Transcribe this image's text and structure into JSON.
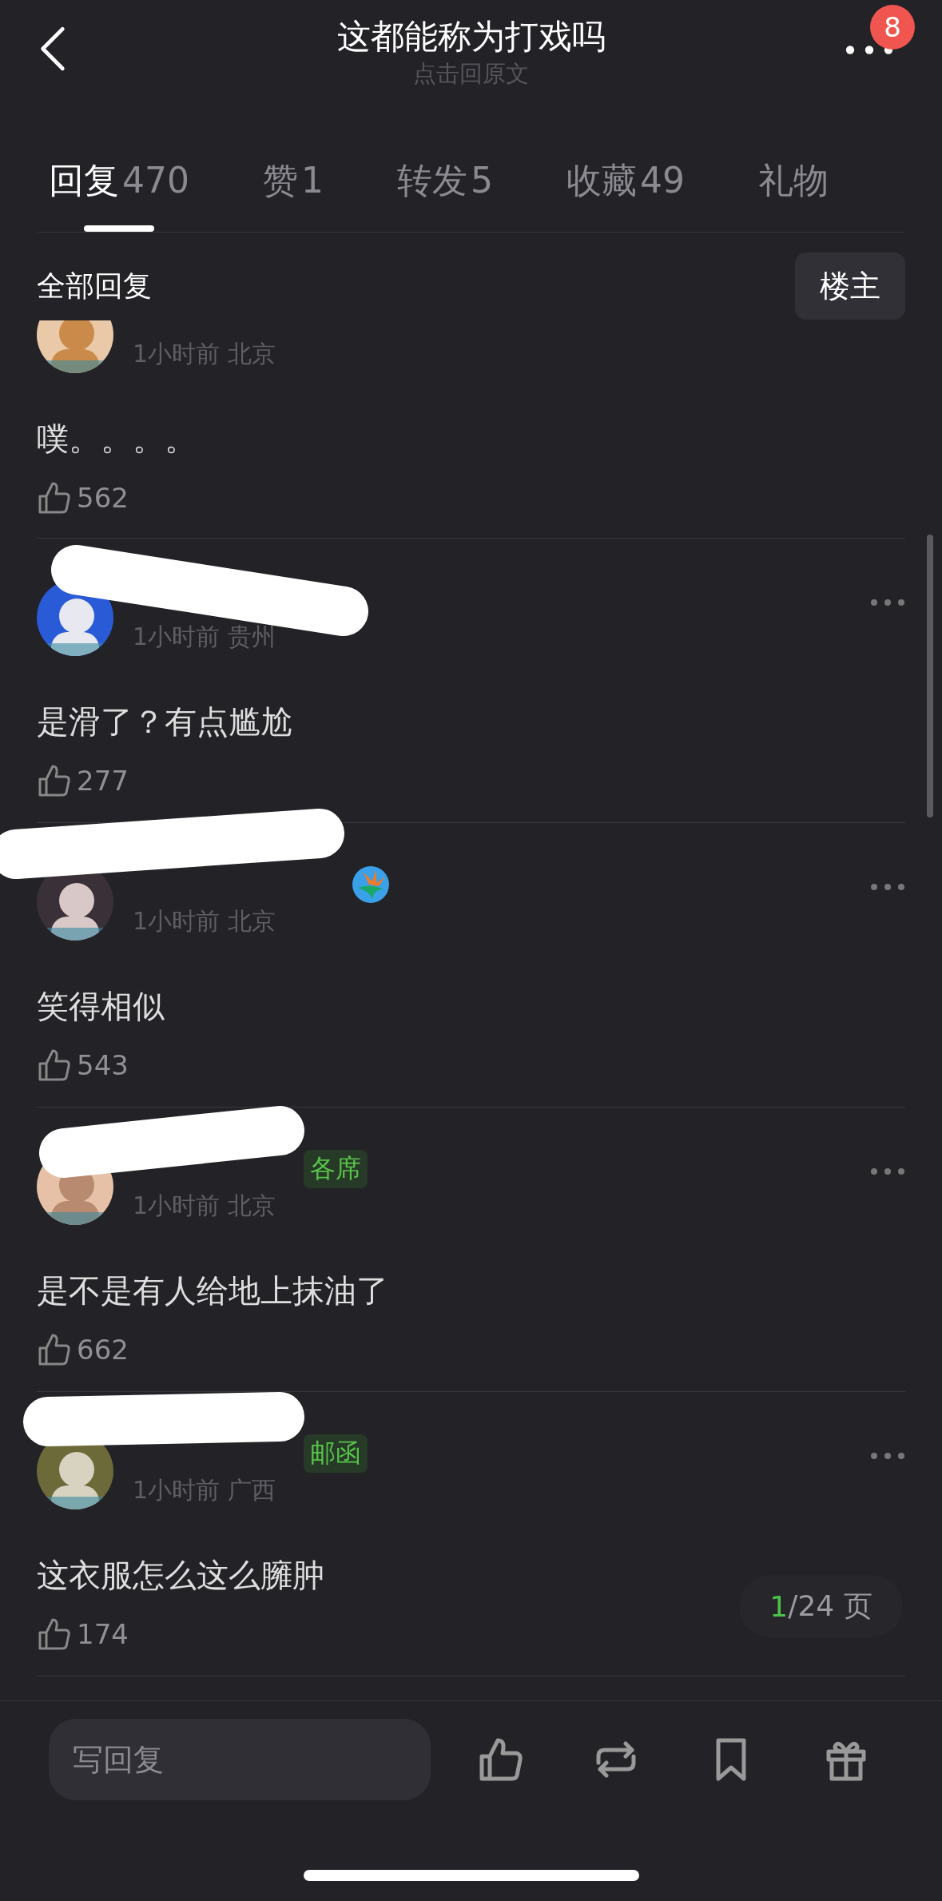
{
  "header": {
    "title": "这都能称为打戏吗",
    "subtitle": "点击回原文",
    "notification_count": "8"
  },
  "tabs": [
    {
      "label": "回复",
      "count": "470",
      "selected": true
    },
    {
      "label": "赞",
      "count": "1",
      "selected": false
    },
    {
      "label": "转发",
      "count": "5",
      "selected": false
    },
    {
      "label": "收藏",
      "count": "49",
      "selected": false
    },
    {
      "label": "礼物",
      "selected": false
    }
  ],
  "filter": {
    "label": "全部回复",
    "button": "楼主"
  },
  "comments": [
    {
      "cut_top": true,
      "redacted": false,
      "time": "1小时前",
      "location": "北京",
      "text": "噗。。。。",
      "likes": "562"
    },
    {
      "cut_top": false,
      "redacted": true,
      "time": "1小时前",
      "location": "贵州",
      "text": "是滑了？有点尴尬",
      "likes": "277"
    },
    {
      "cut_top": false,
      "redacted": true,
      "badge": {
        "kind": "icon"
      },
      "time": "1小时前",
      "location": "北京",
      "text": "笑得相似",
      "likes": "543"
    },
    {
      "cut_top": false,
      "redacted": true,
      "badge": {
        "kind": "tag",
        "text": "各席"
      },
      "time": "1小时前",
      "location": "北京",
      "text": "是不是有人给地上抹油了",
      "likes": "662"
    },
    {
      "cut_top": false,
      "redacted": true,
      "badge": {
        "kind": "tag",
        "text": "邮函"
      },
      "time": "1小时前",
      "location": "广西",
      "text": "这衣服怎么这么臃肿",
      "likes": "174"
    }
  ],
  "pager": {
    "current": "1",
    "rest": "/24 页"
  },
  "composer": {
    "placeholder": "写回复"
  }
}
